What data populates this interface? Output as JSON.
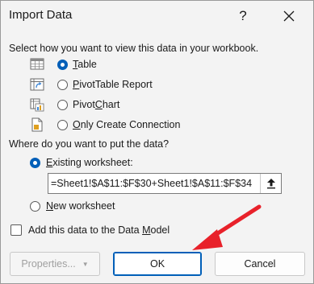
{
  "window": {
    "title": "Import Data",
    "help_label": "?"
  },
  "view_section": {
    "heading": "Select how you want to view this data in your workbook.",
    "options": [
      {
        "pre": "",
        "key": "T",
        "post": "able",
        "checked": true,
        "icon": "table-icon"
      },
      {
        "pre": "",
        "key": "P",
        "post": "ivotTable Report",
        "checked": false,
        "icon": "pivottable-icon"
      },
      {
        "pre": "Pivot",
        "key": "C",
        "post": "hart",
        "checked": false,
        "icon": "pivotchart-icon"
      },
      {
        "pre": "",
        "key": "O",
        "post": "nly Create Connection",
        "checked": false,
        "icon": "connection-icon"
      }
    ]
  },
  "location_section": {
    "heading": "Where do you want to put the data?",
    "existing": {
      "pre": "",
      "key": "E",
      "post": "xisting worksheet:",
      "checked": true
    },
    "reference_value": "=Sheet1!$A$11:$F$30+Sheet1!$A$11:$F$34",
    "new": {
      "pre": "",
      "key": "N",
      "post": "ew worksheet",
      "checked": false
    }
  },
  "data_model": {
    "pre": "Add this data to the Data ",
    "key": "M",
    "post": "odel",
    "checked": false
  },
  "buttons": {
    "properties": "Properties...",
    "ok": "OK",
    "cancel": "Cancel"
  },
  "colors": {
    "accent": "#005fb8",
    "arrow": "#e8212a"
  }
}
